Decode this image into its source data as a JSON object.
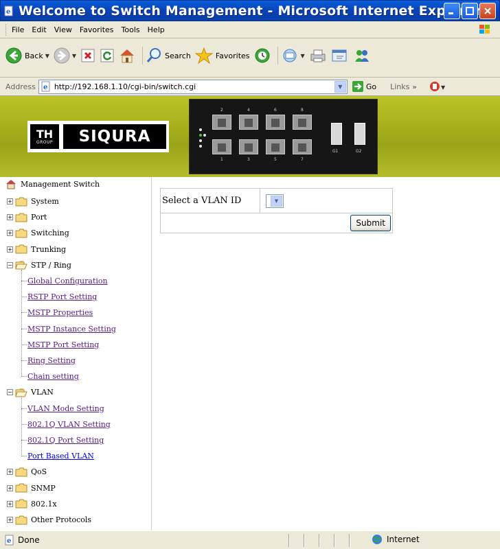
{
  "window": {
    "title": "Welcome to Switch Management - Microsoft Internet Explorer"
  },
  "menu": [
    "File",
    "Edit",
    "View",
    "Favorites",
    "Tools",
    "Help"
  ],
  "toolbar": {
    "back_label": "Back",
    "search_label": "Search",
    "favorites_label": "Favorites"
  },
  "address": {
    "label": "Address",
    "url": "http://192.168.1.10/cgi-bin/switch.cgi",
    "go_label": "Go",
    "links_label": "Links"
  },
  "banner": {
    "logo_group_mark": "TH",
    "logo_group_text": "GROUP",
    "logo_brand": "SIQURA",
    "port_top_labels": [
      "2",
      "4",
      "6",
      "8"
    ],
    "port_bottom_labels": [
      "1",
      "3",
      "5",
      "7"
    ],
    "sfp_labels": [
      "G1",
      "G2"
    ]
  },
  "tree": {
    "root": "Management Switch",
    "items": [
      {
        "label": "System",
        "type": "folder",
        "expanded": false
      },
      {
        "label": "Port",
        "type": "folder",
        "expanded": false
      },
      {
        "label": "Switching",
        "type": "folder",
        "expanded": false
      },
      {
        "label": "Trunking",
        "type": "folder",
        "expanded": false
      },
      {
        "label": "STP / Ring",
        "type": "folder",
        "expanded": true
      },
      {
        "label": "Global Configuration",
        "type": "link"
      },
      {
        "label": "RSTP Port Setting",
        "type": "link"
      },
      {
        "label": "MSTP Properties",
        "type": "link"
      },
      {
        "label": "MSTP Instance Setting",
        "type": "link"
      },
      {
        "label": "MSTP Port Setting",
        "type": "link"
      },
      {
        "label": "Ring Setting",
        "type": "link"
      },
      {
        "label": "Chain setting",
        "type": "link"
      },
      {
        "label": "VLAN",
        "type": "folder",
        "expanded": true
      },
      {
        "label": "VLAN Mode Setting",
        "type": "link"
      },
      {
        "label": "802.1Q VLAN Setting",
        "type": "link"
      },
      {
        "label": "802.1Q Port Setting",
        "type": "link"
      },
      {
        "label": "Port Based VLAN",
        "type": "link",
        "unvisited": true
      },
      {
        "label": "QoS",
        "type": "folder",
        "expanded": false
      },
      {
        "label": "SNMP",
        "type": "folder",
        "expanded": false
      },
      {
        "label": "802.1x",
        "type": "folder",
        "expanded": false
      },
      {
        "label": "Other Protocols",
        "type": "folder",
        "expanded": false
      }
    ]
  },
  "form": {
    "vlan_label": "Select a VLAN ID",
    "vlan_value": "",
    "submit_label": "Submit"
  },
  "status": {
    "text": "Done",
    "zone": "Internet"
  },
  "colors": {
    "xp_blue": "#0842b8",
    "banner_olive": "#a9b11c",
    "visited_link": "#551a8b",
    "link": "#0000ee"
  }
}
